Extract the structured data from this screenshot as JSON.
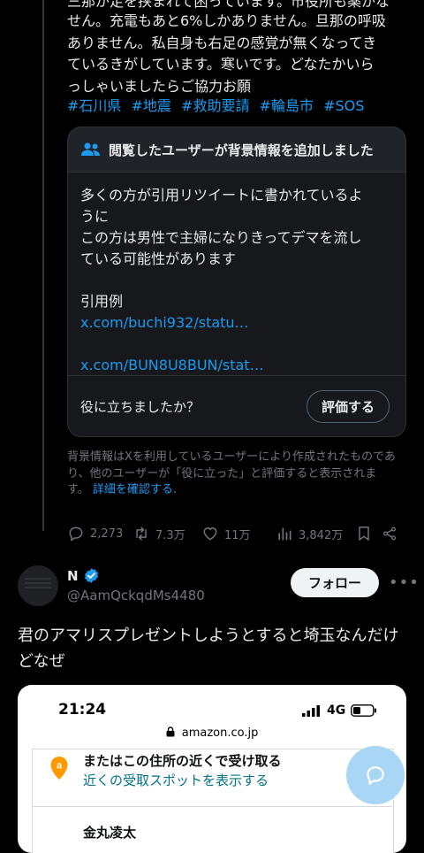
{
  "tweet1": {
    "cut_line": "三那が足を挟まれて困っています。市役所も薬がな",
    "text_lines": [
      "せん。充電もあと6%しかありません。旦那の呼吸",
      "ありません。私自身も右足の感覚が無くなってき",
      "ているきがしています。寒いです。どなたかいら",
      "っしゃいましたらご協力お願"
    ],
    "hashtags": [
      "#石川県",
      "#地震",
      "#救助要請",
      "#輪島市",
      "#SOS"
    ],
    "note": {
      "header": "閲覧したユーザーが背景情報を追加しました",
      "lines": [
        "多くの方が引用リツイートに書かれているよ",
        "うに",
        "この方は男性で主婦になりきってデマを流し",
        "ている可能性があります"
      ],
      "example_label": "引用例",
      "links": [
        "x.com/buchi932/statu…",
        "x.com/BUN8U8BUN/stat…"
      ],
      "helpful_question": "役に立ちましたか？",
      "rate_button": "評価する"
    },
    "disclaimer": "背景情報はXを利用しているユーザーにより作成されたものであり、他のユーザーが「役に立った」と評価すると表示されます。",
    "disclaimer_link": "詳細を確認する.",
    "actions": {
      "replies": "2,273",
      "retweets": "7.3万",
      "likes": "11万",
      "views": "3,842万"
    }
  },
  "tweet2": {
    "name": "N",
    "handle": "@AamQckqdMs4480",
    "follow_button": "フォロー",
    "text": "君のアマリスプレゼントしようとすると埼玉なんだけどなぜ",
    "media": {
      "time": "21:24",
      "network": "4G",
      "url": "amazon.co.jp",
      "pickup_title": "またはこの住所の近くで受け取る",
      "pickup_link": "近くの受取スポットを表示する",
      "cut_name": "金丸凌太"
    }
  },
  "colors": {
    "background": "#000000",
    "link": "#1d9bf0",
    "muted": "#71767b",
    "note_bg": "#16181c",
    "verified": "#1d9bf0",
    "amazon_teal": "#007185",
    "amazon_orange": "#ff9900"
  },
  "icons": [
    "people-icon",
    "reply-icon",
    "retweet-icon",
    "like-icon",
    "views-icon",
    "bookmark-icon",
    "share-icon",
    "verified-badge-icon",
    "more-icon",
    "signal-icon",
    "battery-icon",
    "lock-icon",
    "location-pin-icon",
    "compose-icon"
  ]
}
